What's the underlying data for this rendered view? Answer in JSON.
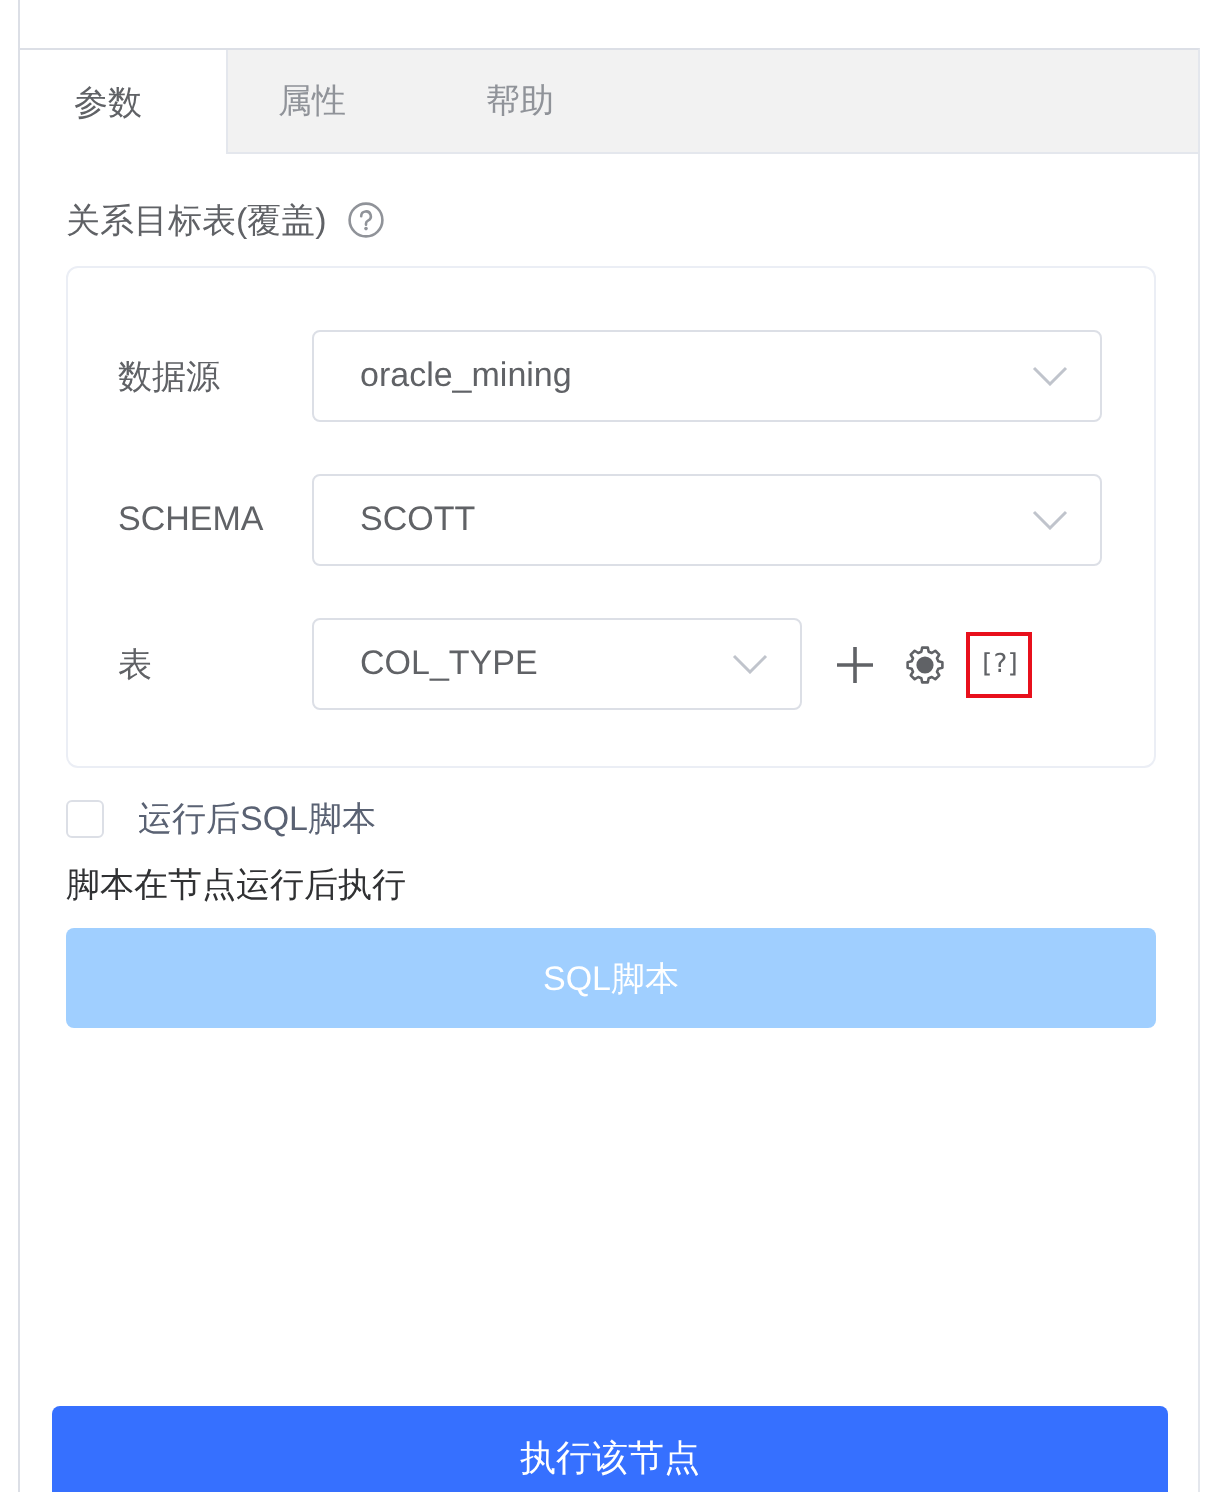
{
  "tabs": [
    {
      "label": "参数",
      "selected": true
    },
    {
      "label": "属性",
      "selected": false
    },
    {
      "label": "帮助",
      "selected": false
    }
  ],
  "section": {
    "title": "关系目标表(覆盖)"
  },
  "fields": [
    {
      "kind": "select",
      "label": "数据源",
      "value": "oracle_mining"
    },
    {
      "kind": "select",
      "label": "SCHEMA",
      "value": "SCOTT"
    },
    {
      "kind": "select_with_actions",
      "label": "表",
      "value": "COL_TYPE",
      "actions": [
        {
          "kind": "add"
        },
        {
          "kind": "settings"
        },
        {
          "kind": "help",
          "text": "[?]",
          "highlighted": true
        }
      ]
    }
  ],
  "post_script": {
    "label": "运行后SQL脚本",
    "checked": false,
    "hint": "脚本在节点运行后执行",
    "button": {
      "label": "SQL脚本",
      "disabled": true
    }
  },
  "execute_button": {
    "label": "执行该节点"
  }
}
